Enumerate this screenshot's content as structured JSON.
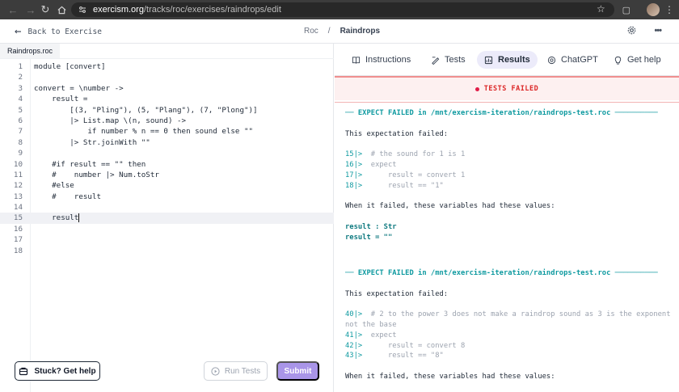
{
  "browser": {
    "url_host": "exercism.org",
    "url_path": "/tracks/roc/exercises/raindrops/edit"
  },
  "header": {
    "back_label": "Back to Exercise",
    "breadcrumb_track": "Roc",
    "breadcrumb_sep": "/",
    "breadcrumb_exercise": "Raindrops"
  },
  "editor": {
    "file_tab": "Raindrops.roc",
    "active_line": 15,
    "lines": [
      {
        "n": "1",
        "t": "module [convert]"
      },
      {
        "n": "2",
        "t": ""
      },
      {
        "n": "3",
        "t": "convert = \\number ->"
      },
      {
        "n": "4",
        "t": "    result ="
      },
      {
        "n": "5",
        "t": "        [(3, \"Pling\"), (5, \"Plang\"), (7, \"Plong\")]"
      },
      {
        "n": "6",
        "t": "        |> List.map \\(n, sound) ->"
      },
      {
        "n": "7",
        "t": "            if number % n == 0 then sound else \"\""
      },
      {
        "n": "8",
        "t": "        |> Str.joinWith \"\""
      },
      {
        "n": "9",
        "t": ""
      },
      {
        "n": "10",
        "t": "    #if result == \"\" then"
      },
      {
        "n": "11",
        "t": "    #    number |> Num.toStr"
      },
      {
        "n": "12",
        "t": "    #else"
      },
      {
        "n": "13",
        "t": "    #    result"
      },
      {
        "n": "14",
        "t": ""
      },
      {
        "n": "15",
        "t": "    result"
      },
      {
        "n": "16",
        "t": ""
      },
      {
        "n": "17",
        "t": ""
      },
      {
        "n": "18",
        "t": ""
      }
    ]
  },
  "buttons": {
    "stuck": "Stuck? Get help",
    "run_tests": "Run Tests",
    "submit": "Submit"
  },
  "tabs": [
    {
      "label": "Instructions",
      "icon": "book-icon"
    },
    {
      "label": "Tests",
      "icon": "tests-icon"
    },
    {
      "label": "Results",
      "icon": "results-icon"
    },
    {
      "label": "ChatGPT",
      "icon": "chatgpt-icon"
    },
    {
      "label": "Get help",
      "icon": "lightbulb-icon"
    }
  ],
  "status": {
    "label": "TESTS FAILED",
    "color": "#dc2626"
  },
  "results": {
    "block1": {
      "header": "── EXPECT FAILED in /mnt/exercism-iteration/raindrops-test.roc ──────────",
      "intro": "This expectation failed:",
      "code": [
        {
          "n": "15|>",
          "t": "  # the sound for 1 is 1",
          "c": "grey"
        },
        {
          "n": "16|>",
          "t": "  expect",
          "c": "grey"
        },
        {
          "n": "17|>",
          "t": "      result = convert 1",
          "c": "grey"
        },
        {
          "n": "18|>",
          "t": "      result == \"1\"",
          "c": "grey"
        }
      ],
      "vars_intro": "When it failed, these variables had these values:",
      "vars": [
        "result : Str",
        "result = \"\""
      ]
    },
    "block2": {
      "header": "── EXPECT FAILED in /mnt/exercism-iteration/raindrops-test.roc ──────────",
      "intro": "This expectation failed:",
      "code": [
        {
          "n": "40|>",
          "t": "  # 2 to the power 3 does not make a raindrop sound as 3 is the exponent not the base",
          "c": "grey"
        },
        {
          "n": "41|>",
          "t": "  expect",
          "c": "grey"
        },
        {
          "n": "42|>",
          "t": "      result = convert 8",
          "c": "grey"
        },
        {
          "n": "43|>",
          "t": "      result == \"8\"",
          "c": "grey"
        }
      ],
      "vars_intro": "When it failed, these variables had these values:"
    }
  },
  "colors": {
    "accent": "#a995e8",
    "active_tab_bg": "#ecebfa",
    "teal": "#0f9aa0"
  }
}
